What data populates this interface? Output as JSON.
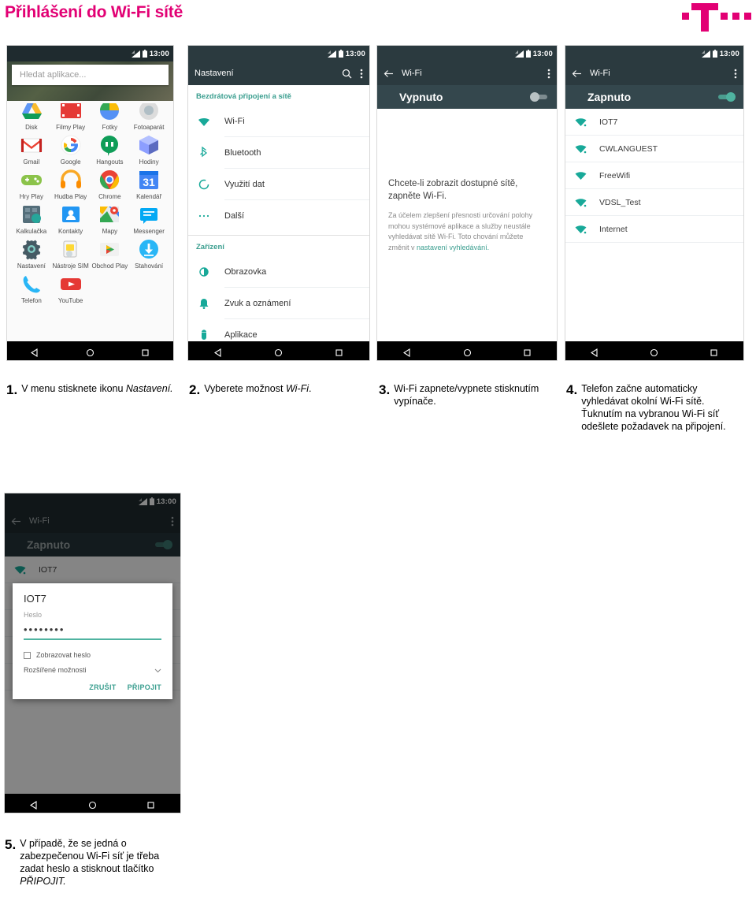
{
  "header": {
    "title": "Přihlášení do Wi-Fi sítě",
    "brand": "t-mobile-logo",
    "title_color": "#e20074"
  },
  "phones": {
    "p1_appdrawer": {
      "status_time": "13:00",
      "search_placeholder": "Hledat aplikace...",
      "apps_row0": [
        "Disk",
        "Filmy Play",
        "Fotky",
        "Fotoaparát"
      ],
      "apps_row1": [
        "Gmail",
        "Google",
        "Hangouts",
        "Hodiny"
      ],
      "apps_row2": [
        "Hry Play",
        "Hudba Play",
        "Chrome",
        "Kalendář"
      ],
      "apps_row3": [
        "Kalkulačka",
        "Kontakty",
        "Mapy",
        "Messenger"
      ],
      "apps_row4": [
        "Nastavení",
        "Nástroje SIM",
        "Obchod Play",
        "Stahování"
      ],
      "apps_row5": [
        "Telefon",
        "YouTube"
      ],
      "calendar_day": "31"
    },
    "p2_settings": {
      "status_time": "13:00",
      "appbar_title": "Nastavení",
      "section_wireless": "Bezdrátová připojení a sítě",
      "items_wireless": [
        "Wi-Fi",
        "Bluetooth",
        "Využití dat",
        "Další"
      ],
      "section_device": "Zařízení",
      "items_device": [
        "Obrazovka",
        "Zvuk a oznámení",
        "Aplikace"
      ]
    },
    "p3_wifi_off": {
      "status_time": "13:00",
      "appbar_title": "Wi-Fi",
      "toggle_label": "Vypnuto",
      "toggle_state": "off",
      "empty_title": "Chcete-li zobrazit dostupné sítě, zapněte Wi-Fi.",
      "empty_text": "Za účelem zlepšení přesnosti určování polohy mohou systémové aplikace a služby neustále vyhledávat sítě Wi-Fi. Toto chování můžete změnit v ",
      "empty_link": "nastavení vyhledávání."
    },
    "p4_wifi_on": {
      "status_time": "13:00",
      "appbar_title": "Wi-Fi",
      "toggle_label": "Zapnuto",
      "toggle_state": "on",
      "networks": [
        "IOT7",
        "CWLANGUEST",
        "FreeWifi",
        "VDSL_Test",
        "Internet"
      ]
    },
    "p5_password": {
      "status_time": "13:00",
      "appbar_title": "Wi-Fi",
      "toggle_label": "Zapnuto",
      "toggle_state": "on",
      "network_behind": "IOT7",
      "dialog": {
        "ssid": "IOT7",
        "password_label": "Heslo",
        "password_value": "••••••••",
        "show_password": "Zobrazovat heslo",
        "advanced": "Rozšířené možnosti",
        "cancel": "ZRUŠIT",
        "connect": "PŘIPOJIT"
      }
    }
  },
  "steps": [
    {
      "num": "1.",
      "text_a": "V menu stisknete ikonu ",
      "text_em": "Nastavení.",
      "text_b": ""
    },
    {
      "num": "2.",
      "text_a": "Vyberete možnost ",
      "text_em": "Wi-Fi",
      "text_b": "."
    },
    {
      "num": "3.",
      "text_a": "Wi-Fi zapnete/vypnete stisknutím vypínače.",
      "text_em": "",
      "text_b": ""
    },
    {
      "num": "4.",
      "text_a": "Telefon začne automaticky vyhledávat okolní Wi-Fi sítě. Ťuknutím na vybranou Wi-Fi síť odešlete požadavek na připojení.",
      "text_em": "",
      "text_b": ""
    },
    {
      "num": "5.",
      "text_a": "V případě, že se jedná o zabezpečenou Wi-Fi síť je třeba zadat heslo a stisknout tlačítko ",
      "text_em": "PŘIPOJIT.",
      "text_b": ""
    }
  ],
  "colors": {
    "magenta": "#e20074",
    "teal": "#3a9e8f",
    "appbar": "#2b3a3f",
    "subbar": "#34474d"
  }
}
